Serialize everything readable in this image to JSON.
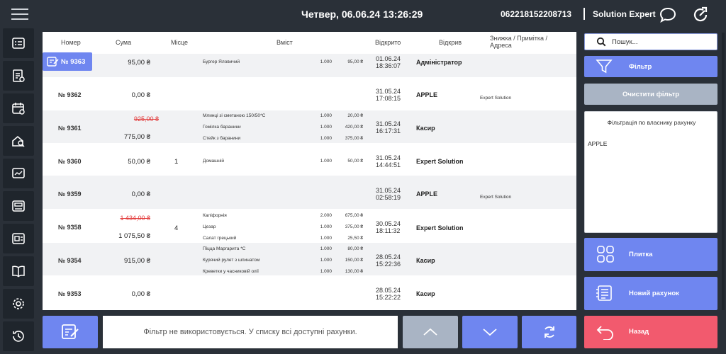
{
  "header": {
    "datetime": "Четвер, 06.06.24 13:26:29",
    "device_id": "062218152208713",
    "user": "Solution Expert",
    "icons": [
      "menu-icon",
      "chat-icon",
      "refresh-arrow-icon"
    ]
  },
  "sidebar": {
    "items": [
      {
        "icon": "checklist-icon"
      },
      {
        "icon": "receipt-icon"
      },
      {
        "icon": "calendar-icon"
      },
      {
        "icon": "home-search-icon"
      },
      {
        "icon": "chart-icon"
      },
      {
        "icon": "register-icon"
      },
      {
        "icon": "card-icon"
      },
      {
        "icon": "book-icon"
      },
      {
        "icon": "settings-icon"
      },
      {
        "icon": "history-icon"
      }
    ]
  },
  "table": {
    "headers": {
      "number": "Номер",
      "sum": "Сума",
      "place": "Місце",
      "content": "Вміст",
      "opened": "Відкрито",
      "opener": "Відкрив",
      "note": "Знижка / Примітка / Адреса"
    },
    "rows": [
      {
        "number": "№ 9363",
        "sum": "95,00 ₴",
        "sum_old": "",
        "place": "",
        "items": [
          {
            "name": "Бургер Яловичий",
            "qty": "1.000",
            "price": "95,00 ₴"
          }
        ],
        "opened_date": "01.06.24",
        "opened_time": "18:36:07",
        "opener": "Адміністратор",
        "note": ""
      },
      {
        "number": "№ 9362",
        "sum": "0,00 ₴",
        "sum_old": "",
        "place": "",
        "items": [],
        "opened_date": "31.05.24",
        "opened_time": "17:08:15",
        "opener": "APPLE",
        "note": "Expert Solution"
      },
      {
        "number": "№ 9361",
        "sum": "775,00 ₴",
        "sum_old": "925,00 ₴",
        "place": "",
        "items": [
          {
            "name": "Млинці зі сметаною 150/50*С",
            "qty": "1.000",
            "price": "20,00 ₴"
          },
          {
            "name": "Гомілка баранини",
            "qty": "1.000",
            "price": "420,00 ₴"
          },
          {
            "name": "Стейк з баранини",
            "qty": "1.000",
            "price": "375,00 ₴"
          }
        ],
        "opened_date": "31.05.24",
        "opened_time": "16:17:31",
        "opener": "Касир",
        "note": ""
      },
      {
        "number": "№ 9360",
        "sum": "50,00 ₴",
        "sum_old": "",
        "place": "1",
        "items": [
          {
            "name": "Домашній",
            "qty": "1.000",
            "price": "50,00 ₴"
          }
        ],
        "opened_date": "31.05.24",
        "opened_time": "14:44:51",
        "opener": "Expert Solution",
        "note": ""
      },
      {
        "number": "№ 9359",
        "sum": "0,00 ₴",
        "sum_old": "",
        "place": "",
        "items": [],
        "opened_date": "31.05.24",
        "opened_time": "02:58:19",
        "opener": "APPLE",
        "note": "Expert Solution"
      },
      {
        "number": "№ 9358",
        "sum": "1 075,50 ₴",
        "sum_old": "1 434,00 ₴",
        "place": "4",
        "items": [
          {
            "name": "Каліфорнія",
            "qty": "2.000",
            "price": "675,00 ₴"
          },
          {
            "name": "Цезар",
            "qty": "1.000",
            "price": "375,00 ₴"
          },
          {
            "name": "Салат грецький",
            "qty": "1.000",
            "price": "25,50 ₴"
          }
        ],
        "opened_date": "30.05.24",
        "opened_time": "18:11:32",
        "opener": "Expert Solution",
        "note": ""
      },
      {
        "number": "№ 9354",
        "sum": "915,00 ₴",
        "sum_old": "",
        "place": "",
        "items": [
          {
            "name": "Піцца Маргарита *С",
            "qty": "1.000",
            "price": "80,00 ₴"
          },
          {
            "name": "Курячий рулет з шпинатом",
            "qty": "1.000",
            "price": "150,00 ₴"
          },
          {
            "name": "Креветки у часниковій олії",
            "qty": "1.000",
            "price": "130,00 ₴"
          }
        ],
        "opened_date": "28.05.24",
        "opened_time": "15:22:36",
        "opener": "Касир",
        "note": ""
      },
      {
        "number": "№ 9353",
        "sum": "0,00 ₴",
        "sum_old": "",
        "place": "",
        "items": [],
        "opened_date": "28.05.24",
        "opened_time": "15:22:22",
        "opener": "Касир",
        "note": ""
      }
    ]
  },
  "bottom": {
    "info": "Фільтр не використовується. У списку всі доступні рахунки."
  },
  "right": {
    "search_placeholder": "Пошук...",
    "filter_label": "Фільтр",
    "clear_filter_label": "Очистити фільтр",
    "own_filter_title": "Фільтрація по власнику рахунку",
    "own_filter_value": "APPLE",
    "tiles_label": "Плитка",
    "new_bill_label": "Новий рахунок",
    "back_label": "Назад"
  },
  "colors": {
    "accent": "#6f86f0",
    "disabled": "#a9b4c4",
    "danger": "#f25a6e",
    "strike": "#e23b3b",
    "background": "#2a3038"
  }
}
